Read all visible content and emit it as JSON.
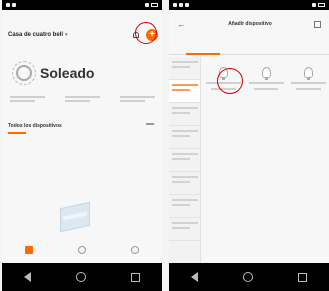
{
  "left_screen": {
    "header_title": "Casa de cuatro bell",
    "weather": "Soleado",
    "devices_title": "Todos los dispositivos"
  },
  "right_screen": {
    "title": "Añadir dispositivo"
  },
  "colors": {
    "accent": "#ff6a00",
    "highlight": "#d60000"
  },
  "icons": [
    "plus-icon",
    "bell-icon",
    "sun-icon",
    "bulb-icon",
    "back-icon",
    "scan-icon"
  ]
}
